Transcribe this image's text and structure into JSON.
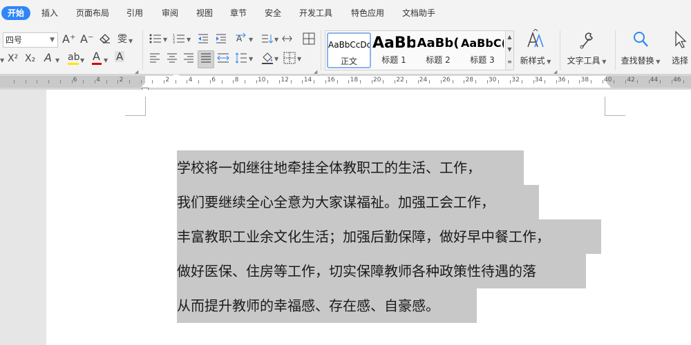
{
  "menu": {
    "tabs": [
      "开始",
      "插入",
      "页面布局",
      "引用",
      "审阅",
      "视图",
      "章节",
      "安全",
      "开发工具",
      "特色应用",
      "文档助手"
    ]
  },
  "ribbon": {
    "font_size": "四号",
    "styles": [
      {
        "sample": "AaBbCcDd",
        "name": "正文"
      },
      {
        "sample": "AaBb",
        "name": "标题 1"
      },
      {
        "sample": "AaBb(",
        "name": "标题 2"
      },
      {
        "sample": "AaBbC(",
        "name": "标题 3"
      }
    ],
    "new_style": "新样式",
    "text_tools": "文字工具",
    "find_replace": "查找替换",
    "select": "选择",
    "icons": {
      "grow_font": "A⁺",
      "shrink_font": "A⁻",
      "eraser": "⌫",
      "phonetic": "雯",
      "superscript": "X²",
      "subscript": "X₂",
      "text_effect": "A",
      "highlight": "ab",
      "font_color": "A",
      "char_shading": "A"
    }
  },
  "ruler": {
    "numbers": [
      "6",
      "4",
      "2",
      "2",
      "4",
      "6",
      "8",
      "10",
      "12",
      "14",
      "16",
      "18",
      "20",
      "22",
      "24",
      "26",
      "28",
      "30",
      "32",
      "34",
      "36",
      "38",
      "40",
      "42",
      "44",
      "46"
    ]
  },
  "document": {
    "paragraphs": [
      "学校将一如继往地牵挂全体教职工的生活、工作，",
      "我们要继续全心全意为大家谋福祉。加强工会工作，",
      "丰富教职工业余文化生活；加强后勤保障，做好早中餐工作，",
      "做好医保、住房等工作，切实保障教师各种政策性待遇的落",
      "从而提升教师的幸福感、存在感、自豪感。"
    ]
  },
  "colors": {
    "accent": "#2f86f6",
    "selection": "#c8c8c8",
    "font_color_bar": "#d40000",
    "highlight_bar": "#ffe600"
  }
}
